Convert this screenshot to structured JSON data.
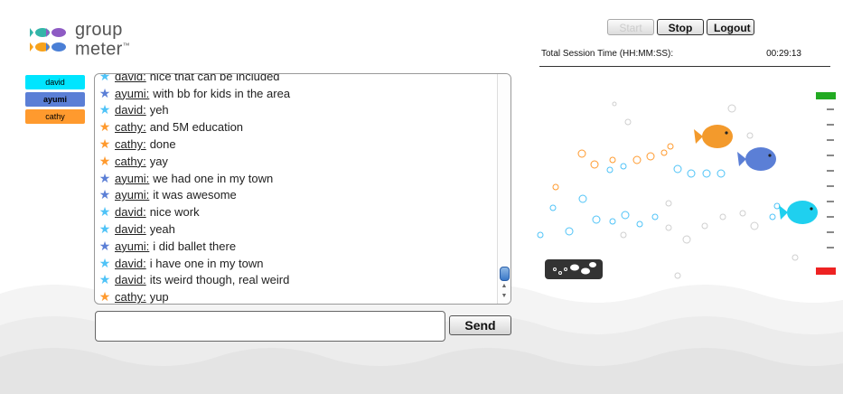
{
  "app": {
    "logo_line1": "group",
    "logo_line2": "meter",
    "logo_tm": "™"
  },
  "controls": {
    "start_label": "Start",
    "stop_label": "Stop",
    "logout_label": "Logout"
  },
  "session": {
    "label": "Total Session Time (HH:MM:SS):",
    "value": "00:29:13"
  },
  "participants": [
    {
      "name": "david",
      "color": "#00e5ff"
    },
    {
      "name": "ayumi",
      "color": "#5b7fd6"
    },
    {
      "name": "cathy",
      "color": "#ff9a2e"
    }
  ],
  "messages": [
    {
      "user": "david:",
      "text": "nice that can be included",
      "star": "#4fc3f7"
    },
    {
      "user": "ayumi:",
      "text": "with bb for kids in the area",
      "star": "#5b7fd6"
    },
    {
      "user": "david:",
      "text": "yeh",
      "star": "#4fc3f7"
    },
    {
      "user": "cathy:",
      "text": "and 5M education",
      "star": "#ff9a2e"
    },
    {
      "user": "cathy:",
      "text": "done",
      "star": "#ff9a2e"
    },
    {
      "user": "cathy:",
      "text": "yay",
      "star": "#ff9a2e"
    },
    {
      "user": "ayumi:",
      "text": "we had one in my town",
      "star": "#5b7fd6"
    },
    {
      "user": "ayumi:",
      "text": "it was awesome",
      "star": "#5b7fd6"
    },
    {
      "user": "david:",
      "text": "nice work",
      "star": "#4fc3f7"
    },
    {
      "user": "david:",
      "text": "yeah",
      "star": "#4fc3f7"
    },
    {
      "user": "ayumi:",
      "text": "i did ballet there",
      "star": "#5b7fd6"
    },
    {
      "user": "david:",
      "text": "i have one in my town",
      "star": "#4fc3f7"
    },
    {
      "user": "david:",
      "text": "its weird though, real weird",
      "star": "#4fc3f7"
    },
    {
      "user": "cathy:",
      "text": "yup",
      "star": "#ff9a2e"
    }
  ],
  "composer": {
    "value": "",
    "send_label": "Send"
  },
  "colors": {
    "gauge_top": "#22aa22",
    "gauge_bottom": "#ee2222"
  }
}
